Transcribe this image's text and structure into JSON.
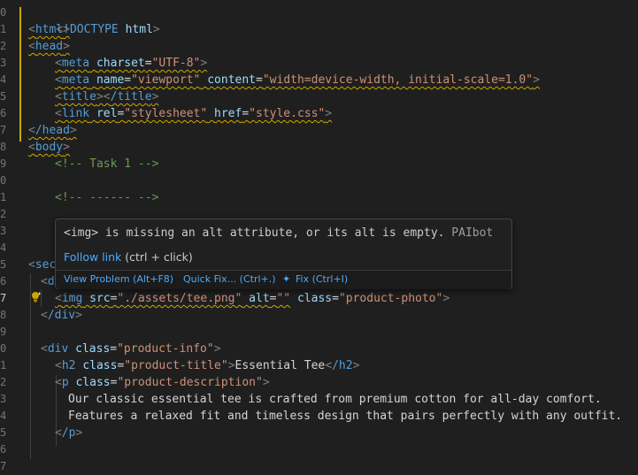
{
  "editor": {
    "line_numbers": [
      "0",
      "1",
      "2",
      "3",
      "4",
      "5",
      "6",
      "7",
      "8",
      "9",
      "0",
      "1",
      "2",
      "3",
      "4",
      "5",
      "6",
      "7",
      "8",
      "9",
      "0",
      "1",
      "2",
      "3",
      "4",
      "5",
      "6",
      "7"
    ],
    "lines": {
      "l1": "<!DOCTYPE html>",
      "l2_tag": "html",
      "l3_tag": "head",
      "l4": {
        "tag": "meta",
        "attr1": "charset",
        "val1": "\"UTF-8\""
      },
      "l5": {
        "tag": "meta",
        "attr1": "name",
        "val1": "\"viewport\"",
        "attr2": "content",
        "val2": "\"width=device-width, initial-scale=1.0\""
      },
      "l6": {
        "tag": "title",
        "close": "/title"
      },
      "l7": {
        "tag": "link",
        "attr1": "rel",
        "val1": "\"stylesheet\"",
        "attr2": "href",
        "val2": "\"style.css\""
      },
      "l8_tag": "/head",
      "l9_tag": "body",
      "l10_comment": "<!-- Task 1 -->",
      "l12_comment": "<!-- ------ -->",
      "l15_partial": "sec",
      "l16_partial": "d",
      "l17": {
        "tag": "img",
        "attr1": "src",
        "val1": "\"./assets/tee.png\"",
        "attr2": "alt",
        "val2": "\"\"",
        "attr3": "class",
        "val3": "\"product-photo\""
      },
      "l18_tag": "/div",
      "l20": {
        "tag": "div",
        "attr1": "class",
        "val1": "\"product-info\""
      },
      "l21": {
        "tag": "h2",
        "attr1": "class",
        "val1": "\"product-title\"",
        "text": "Essential Tee",
        "close": "/h2"
      },
      "l22": {
        "tag": "p",
        "attr1": "class",
        "val1": "\"product-description\""
      },
      "l23_text": "Our classic essential tee is crafted from premium cotton for all-day comfort.",
      "l24_text": "Features a relaxed fit and timeless design that pairs perfectly with any outfit.",
      "l25_tag": "/p"
    }
  },
  "hover": {
    "message": "<img> is missing an alt attribute, or its alt is empty.",
    "source": "PAIbot",
    "follow_link": "Follow link",
    "follow_hint": " (ctrl + click)",
    "actions": {
      "view_problem": "View Problem (Alt+F8)",
      "quick_fix": "Quick Fix... (Ctrl+.)",
      "fix": "Fix (Ctrl+I)"
    }
  },
  "colors": {
    "background": "#1f1f1f",
    "tag": "#569cd6",
    "attribute": "#9cdcfe",
    "string": "#ce9178",
    "comment": "#6a9955",
    "warning": "#cca700",
    "link": "#4daafc"
  }
}
